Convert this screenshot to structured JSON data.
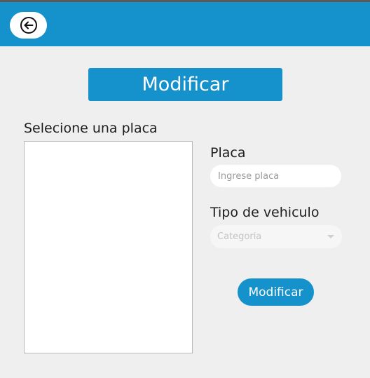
{
  "header": {
    "back_icon": "arrow-left-circle-icon",
    "accent_color": "#1591cc"
  },
  "title_button": {
    "label": "Modificar"
  },
  "plate_list": {
    "label": "Selecione una placa",
    "items": []
  },
  "form": {
    "plate": {
      "label": "Placa",
      "placeholder": "Ingrese placa",
      "value": ""
    },
    "vehicle_type": {
      "label": "Tipo de vehiculo",
      "selected": "Categoria",
      "icon": "chevron-down-icon"
    },
    "submit_label": "Modificar"
  }
}
